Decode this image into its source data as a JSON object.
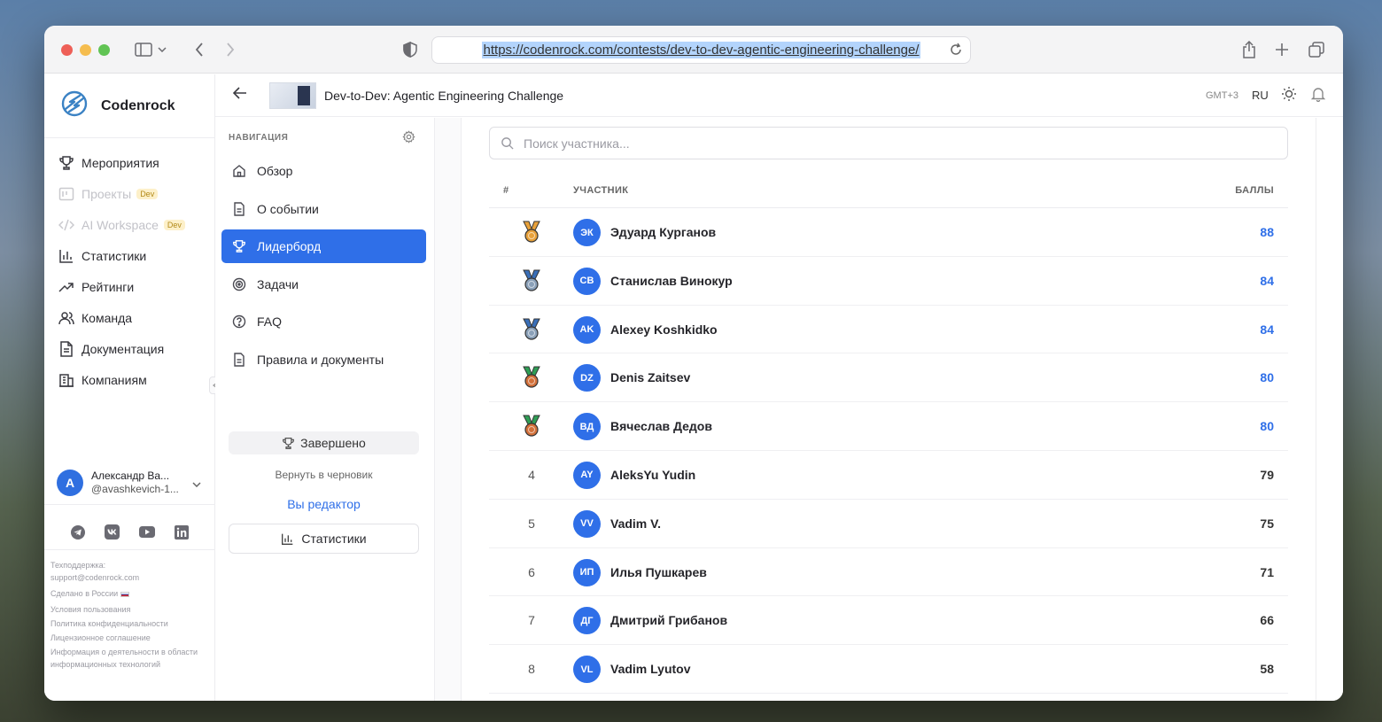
{
  "browser": {
    "url": "https://codenrock.com/contests/dev-to-dev-agentic-engineering-challenge/"
  },
  "brand": {
    "name": "Codenrock"
  },
  "sidebar": {
    "items": [
      {
        "label": "Мероприятия",
        "icon": "trophy-icon",
        "disabled": false
      },
      {
        "label": "Проекты",
        "icon": "kanban-icon",
        "disabled": true,
        "badge": "Dev"
      },
      {
        "label": "AI Workspace",
        "icon": "code-icon",
        "disabled": true,
        "badge": "Dev"
      },
      {
        "label": "Статистики",
        "icon": "bar-chart-icon",
        "disabled": false
      },
      {
        "label": "Рейтинги",
        "icon": "trending-up-icon",
        "disabled": false
      },
      {
        "label": "Команда",
        "icon": "users-icon",
        "disabled": false
      },
      {
        "label": "Документация",
        "icon": "document-icon",
        "disabled": false
      },
      {
        "label": "Компаниям",
        "icon": "building-icon",
        "disabled": false
      }
    ],
    "user": {
      "initial": "A",
      "name": "Александр Ва...",
      "handle": "@avashkevich-1..."
    },
    "footer": {
      "support_label": "Техподдержка:",
      "support_email": "support@codenrock.com",
      "made_in": "Сделано в России",
      "terms": "Условия пользования",
      "privacy": "Политика конфиденциальности",
      "license": "Лицензионное соглашение",
      "it_info": "Информация о деятельности в области информационных технологий"
    }
  },
  "header": {
    "title": "Dev-to-Dev: Agentic Engineering Challenge",
    "timezone": "GMT+3",
    "lang": "RU"
  },
  "event_nav": {
    "heading": "НАВИГАЦИЯ",
    "items": [
      {
        "label": "Обзор",
        "icon": "home-icon",
        "active": false
      },
      {
        "label": "О событии",
        "icon": "document-icon",
        "active": false
      },
      {
        "label": "Лидерборд",
        "icon": "trophy-icon",
        "active": true
      },
      {
        "label": "Задачи",
        "icon": "target-icon",
        "active": false
      },
      {
        "label": "FAQ",
        "icon": "help-circle-icon",
        "active": false
      },
      {
        "label": "Правила и документы",
        "icon": "document-icon",
        "active": false
      }
    ],
    "status": "Завершено",
    "draft_link": "Вернуть в черновик",
    "editor_link": "Вы редактор",
    "stats_button": "Статистики"
  },
  "leaderboard": {
    "search_placeholder": "Поиск участника...",
    "col_rank": "#",
    "col_participant": "УЧАСТНИК",
    "col_score": "БАЛЛЫ",
    "rows": [
      {
        "rank": "",
        "medal": "gold",
        "initials": "ЭК",
        "name": "Эдуард Курганов",
        "score": "88",
        "highlight": true
      },
      {
        "rank": "",
        "medal": "silver",
        "initials": "СВ",
        "name": "Станислав Винокур",
        "score": "84",
        "highlight": true
      },
      {
        "rank": "",
        "medal": "silver",
        "initials": "AK",
        "name": "Alexey Koshkidko",
        "score": "84",
        "highlight": true
      },
      {
        "rank": "",
        "medal": "bronze",
        "initials": "DZ",
        "name": "Denis Zaitsev",
        "score": "80",
        "highlight": true
      },
      {
        "rank": "",
        "medal": "bronze",
        "initials": "ВД",
        "name": "Вячеслав Дедов",
        "score": "80",
        "highlight": true
      },
      {
        "rank": "4",
        "medal": "",
        "initials": "AY",
        "name": "AleksYu Yudin",
        "score": "79",
        "highlight": false
      },
      {
        "rank": "5",
        "medal": "",
        "initials": "VV",
        "name": "Vadim V.",
        "score": "75",
        "highlight": false
      },
      {
        "rank": "6",
        "medal": "",
        "initials": "ИП",
        "name": "Илья Пушкарев",
        "score": "71",
        "highlight": false
      },
      {
        "rank": "7",
        "medal": "",
        "initials": "ДГ",
        "name": "Дмитрий Грибанов",
        "score": "66",
        "highlight": false
      },
      {
        "rank": "8",
        "medal": "",
        "initials": "VL",
        "name": "Vadim Lyutov",
        "score": "58",
        "highlight": false
      }
    ]
  },
  "colors": {
    "accent": "#2f6fe8",
    "medal_gold": "#e8a13a",
    "medal_silver": "#8aa0b8",
    "medal_bronze": "#d2703a",
    "ribbon_green": "#2e9e55",
    "ribbon_blue": "#3a6fb8"
  }
}
